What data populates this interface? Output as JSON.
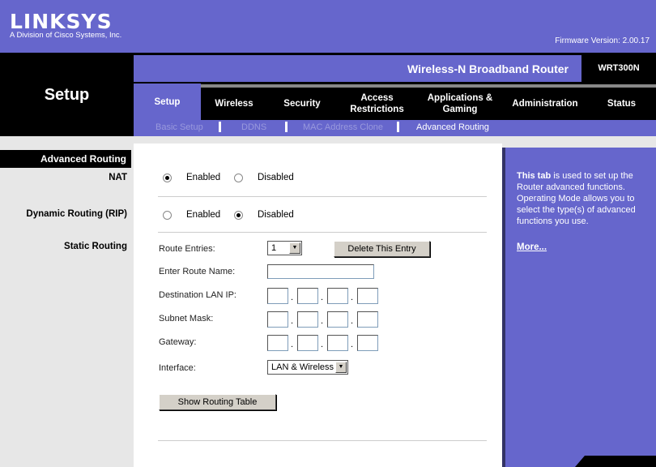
{
  "header": {
    "logo": "LINKSYS",
    "logo_sub": "A Division of Cisco Systems, Inc.",
    "firmware": "Firmware Version: 2.00.17",
    "product": "Wireless-N Broadband Router",
    "model": "WRT300N",
    "section": "Setup"
  },
  "tabs": [
    "Setup",
    "Wireless",
    "Security",
    "Access Restrictions",
    "Applications & Gaming",
    "Administration",
    "Status"
  ],
  "subtabs": [
    "Basic Setup",
    "DDNS",
    "MAC Address Clone",
    "Advanced Routing"
  ],
  "left": {
    "section": "Advanced Routing",
    "nat": "NAT",
    "rip": "Dynamic Routing (RIP)",
    "static": "Static Routing"
  },
  "form": {
    "nat": {
      "enabled": "Enabled",
      "disabled": "Disabled",
      "value": "Enabled"
    },
    "rip": {
      "enabled": "Enabled",
      "disabled": "Disabled",
      "value": "Disabled"
    },
    "route_entries_label": "Route Entries:",
    "route_entries_value": "1",
    "delete_button": "Delete This Entry",
    "route_name_label": "Enter Route Name:",
    "route_name_value": "",
    "dest_ip_label": "Destination LAN IP:",
    "subnet_label": "Subnet Mask:",
    "gateway_label": "Gateway:",
    "interface_label": "Interface:",
    "interface_value": "LAN & Wireless",
    "show_table_button": "Show Routing Table"
  },
  "help": {
    "bold": "This tab",
    "text": " is used to set up the Router advanced functions. Operating Mode allows you to select the type(s) of advanced functions you use.",
    "more": "More..."
  },
  "colors": {
    "brand": "#6666cc",
    "dark": "#000000"
  }
}
